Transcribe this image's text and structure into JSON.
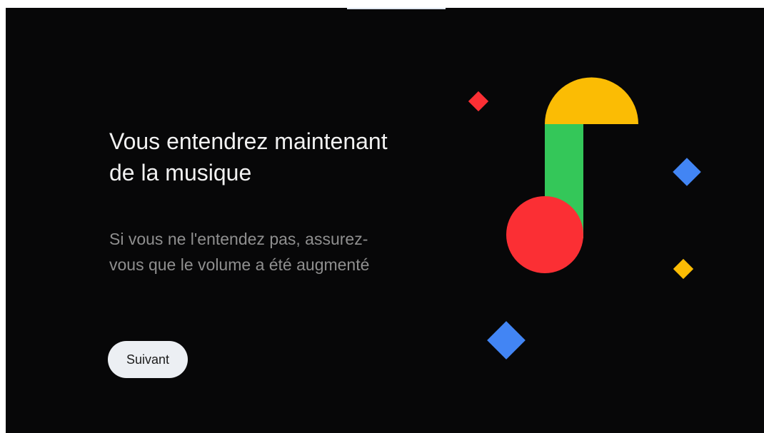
{
  "screen": {
    "title": "Vous entendrez maintenant de la musique",
    "subtitle": "Si vous ne l'entendez pas, assurez-vous que le volume a été augmenté",
    "next_label": "Suivant"
  },
  "illustration": {
    "name": "music-note-illustration",
    "colors": {
      "red": "#fb2f34",
      "yellow": "#fbbc04",
      "green": "#34c759",
      "blue": "#4285f4",
      "background": "#070708"
    }
  }
}
